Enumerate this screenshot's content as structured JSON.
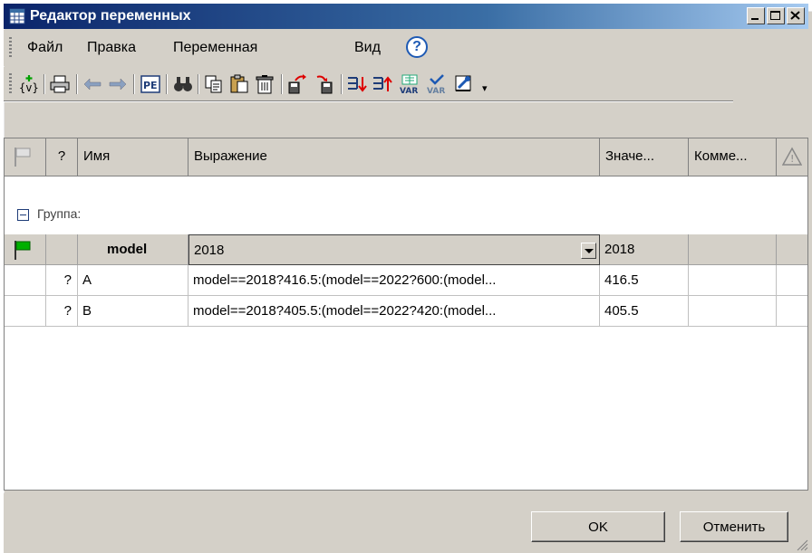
{
  "window": {
    "title": "Редактор переменных"
  },
  "menu": {
    "items": [
      "Файл",
      "Правка",
      "Переменная",
      "Вид"
    ]
  },
  "toolbar": {
    "icons": [
      "new-variable-icon",
      "print-icon",
      "undo-icon",
      "redo-icon",
      "properties-icon",
      "find-icon",
      "copy-icon",
      "paste-icon",
      "delete-icon",
      "import-icon",
      "export-icon",
      "move-down-icon",
      "move-up-icon",
      "new-var-icon",
      "check-var-icon",
      "settings-icon"
    ]
  },
  "columns": {
    "flag": "",
    "q": "?",
    "name": "Имя",
    "expression": "Выражение",
    "value": "Значе...",
    "comment": "Комме...",
    "warning": "!"
  },
  "group": {
    "label": "Группа:"
  },
  "rows": [
    {
      "q": "",
      "name": "model",
      "expression": "2018",
      "value": "2018",
      "comment": ""
    },
    {
      "q": "?",
      "name": "A",
      "expression": "model==2018?416.5:(model==2022?600:(model...",
      "value": "416.5",
      "comment": ""
    },
    {
      "q": "?",
      "name": "B",
      "expression": "model==2018?405.5:(model==2022?420:(model...",
      "value": "405.5",
      "comment": ""
    }
  ],
  "buttons": {
    "ok": "OK",
    "cancel": "Отменить"
  },
  "colors": {
    "titlebar_start": "#0a246a",
    "titlebar_end": "#a6caf0",
    "flag_green": "#00a000"
  }
}
